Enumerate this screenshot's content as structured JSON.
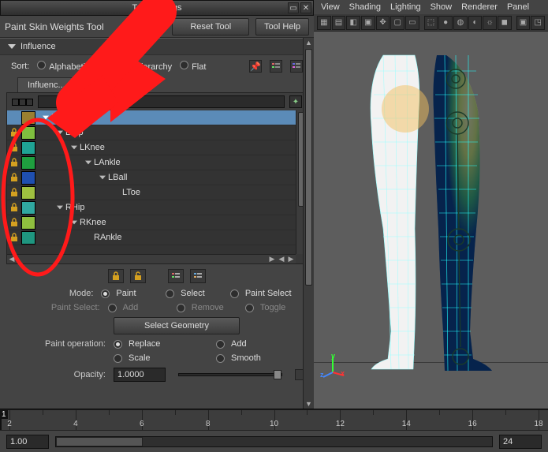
{
  "window": {
    "title": "Tool Settings"
  },
  "tool": {
    "title": "Paint Skin Weights Tool",
    "reset_btn": "Reset Tool",
    "help_btn": "Tool Help"
  },
  "influence": {
    "section_label": "Influence",
    "sort_label": "Sort:",
    "sort_options": [
      "Alphabetically",
      "By Hierarchy",
      "Flat"
    ],
    "tab_label": "Influenc...",
    "tree": [
      {
        "label": "Root",
        "indent": 0,
        "swatch": "#9a7f30",
        "locked": false,
        "selected": true,
        "expandable": true
      },
      {
        "label": "LHip",
        "indent": 1,
        "swatch": "#7fbf3f",
        "locked": true,
        "selected": false,
        "expandable": true
      },
      {
        "label": "LKnee",
        "indent": 2,
        "swatch": "#1fa394",
        "locked": true,
        "selected": false,
        "expandable": true
      },
      {
        "label": "LAnkle",
        "indent": 3,
        "swatch": "#1f9f3f",
        "locked": true,
        "selected": false,
        "expandable": true
      },
      {
        "label": "LBall",
        "indent": 4,
        "swatch": "#1f4fb0",
        "locked": true,
        "selected": false,
        "expandable": true
      },
      {
        "label": "LToe",
        "indent": 5,
        "swatch": "#9fc040",
        "locked": true,
        "selected": false,
        "expandable": false
      },
      {
        "label": "RHip",
        "indent": 1,
        "swatch": "#30a8a0",
        "locked": true,
        "selected": false,
        "expandable": true
      },
      {
        "label": "RKnee",
        "indent": 2,
        "swatch": "#8fbf3f",
        "locked": true,
        "selected": false,
        "expandable": true
      },
      {
        "label": "RAnkle",
        "indent": 3,
        "swatch": "#1f9680",
        "locked": true,
        "selected": false,
        "expandable": false
      }
    ]
  },
  "mode": {
    "label": "Mode:",
    "options": [
      "Paint",
      "Select",
      "Paint Select"
    ],
    "selected": "Paint"
  },
  "paint_select": {
    "label": "Paint Select:",
    "options": [
      "Add",
      "Remove",
      "Toggle"
    ]
  },
  "select_geometry_btn": "Select Geometry",
  "paint_operation": {
    "label": "Paint operation:",
    "options": [
      "Replace",
      "Add",
      "Scale",
      "Smooth"
    ],
    "selected": "Replace"
  },
  "opacity": {
    "label": "Opacity:",
    "value": "1.0000"
  },
  "viewport": {
    "menus": [
      "View",
      "Shading",
      "Lighting",
      "Show",
      "Renderer",
      "Panel"
    ]
  },
  "timeline": {
    "ticks": [
      2,
      4,
      6,
      8,
      10,
      12,
      14,
      16,
      18
    ],
    "cursor": 1,
    "range_start": "1.00",
    "range_end": "24"
  }
}
